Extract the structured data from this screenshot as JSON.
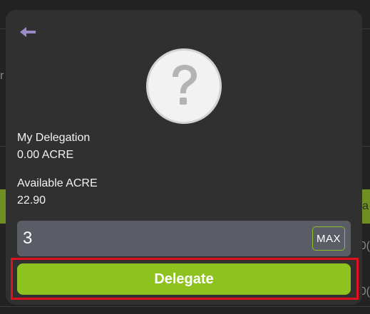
{
  "modal": {
    "my_delegation_label": "My Delegation",
    "my_delegation_value": "0.00 ACRE",
    "available_label": "Available ACRE",
    "available_value": "22.90"
  },
  "amount": {
    "value": "3",
    "max_label": "MAX"
  },
  "action": {
    "delegate_label": "Delegate"
  },
  "background": {
    "fragment_left": "r",
    "fragment_right_1": "a",
    "fragment_right_2": "0(",
    "fragment_right_3": "0("
  },
  "icons": {
    "back": "back-arrow-icon",
    "avatar": "question-mark-icon"
  },
  "colors": {
    "accent": "#8ec21e",
    "modal_bg": "#303030",
    "input_bg": "#5a5d66",
    "highlight": "#e0101f",
    "back_arrow": "#9a8ac8"
  }
}
